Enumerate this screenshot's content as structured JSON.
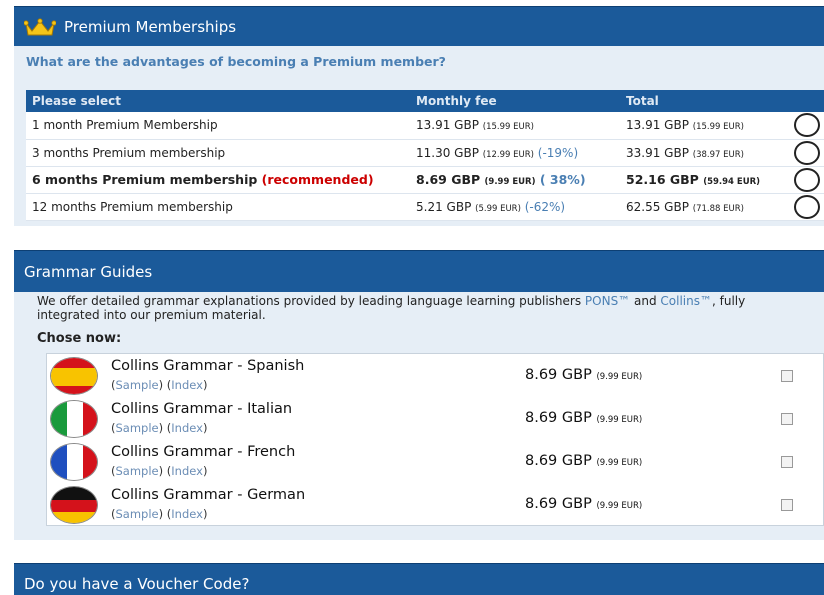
{
  "premium": {
    "title": "Premium Memberships",
    "question": "What are the advantages of becoming a Premium member?",
    "headers": {
      "select": "Please select",
      "fee": "Monthly fee",
      "total": "Total"
    },
    "rows": [
      {
        "name": "1 month Premium Membership",
        "recommended": "",
        "fee": "13.91 GBP",
        "fee_eur": "(15.99 EUR)",
        "discount": "",
        "total": "13.91 GBP",
        "total_eur": "(15.99 EUR)"
      },
      {
        "name": "3 months Premium membership",
        "recommended": "",
        "fee": "11.30 GBP",
        "fee_eur": "(12.99 EUR)",
        "discount": "(-19%)",
        "total": "33.91 GBP",
        "total_eur": "(38.97 EUR)"
      },
      {
        "name": "6 months Premium membership",
        "recommended": "(recommended)",
        "fee": "8.69 GBP",
        "fee_eur": "(9.99 EUR)",
        "discount": "( 38%)",
        "total": "52.16 GBP",
        "total_eur": "(59.94 EUR)"
      },
      {
        "name": "12 months Premium membership",
        "recommended": "",
        "fee": "5.21 GBP",
        "fee_eur": "(5.99 EUR)",
        "discount": "(-62%)",
        "total": "62.55 GBP",
        "total_eur": "(71.88 EUR)"
      }
    ]
  },
  "grammar": {
    "title": "Grammar Guides",
    "intro_pre": "We offer detailed grammar explanations provided by leading language learning publishers ",
    "intro_link1": "PONS™",
    "intro_and": " and ",
    "intro_link2": "Collins™",
    "intro_post": ", fully integrated into our premium material.",
    "chose": "Chose now:",
    "items": [
      {
        "name": "Collins Grammar - Spanish",
        "sample": "Sample",
        "index": "Index",
        "price": "8.69 GBP",
        "price_eur": "(9.99 EUR)"
      },
      {
        "name": "Collins Grammar - Italian",
        "sample": "Sample",
        "index": "Index",
        "price": "8.69 GBP",
        "price_eur": "(9.99 EUR)"
      },
      {
        "name": "Collins Grammar - French",
        "sample": "Sample",
        "index": "Index",
        "price": "8.69 GBP",
        "price_eur": "(9.99 EUR)"
      },
      {
        "name": "Collins Grammar - German",
        "sample": "Sample",
        "index": "Index",
        "price": "8.69 GBP",
        "price_eur": "(9.99 EUR)"
      }
    ],
    "flags": [
      "spain-flag-icon",
      "italy-flag-icon",
      "france-flag-icon",
      "germany-flag-icon"
    ]
  },
  "voucher": {
    "title": "Do you have a Voucher Code?"
  },
  "colors": {
    "header_blue": "#1b5a9a",
    "panel_bg": "#e6eef6",
    "link_blue": "#4a7fb3",
    "recommended_red": "#cc0000"
  }
}
